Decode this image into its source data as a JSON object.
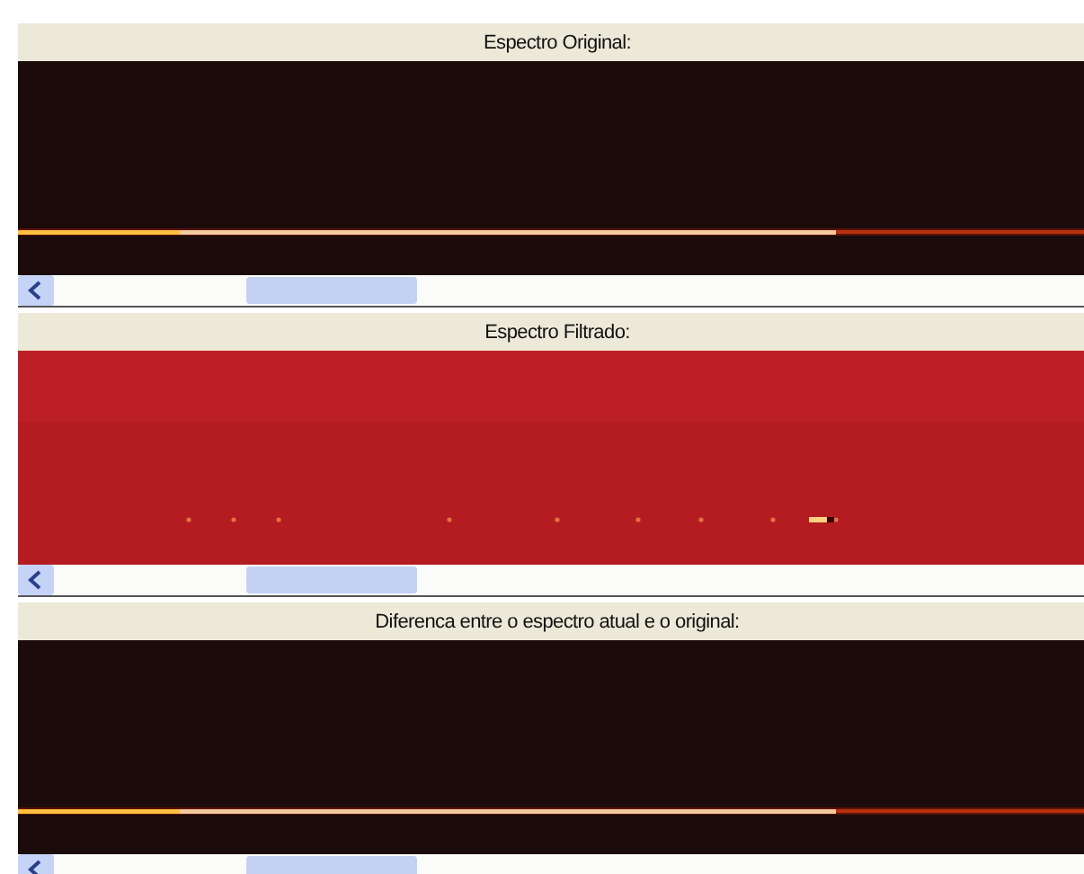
{
  "panels": [
    {
      "title": "Espectro Original:",
      "kind": "dark"
    },
    {
      "title": "Espectro Filtrado:",
      "kind": "filtered"
    },
    {
      "title": "Diferenca entre o espectro atual e o original:",
      "kind": "dark"
    }
  ]
}
